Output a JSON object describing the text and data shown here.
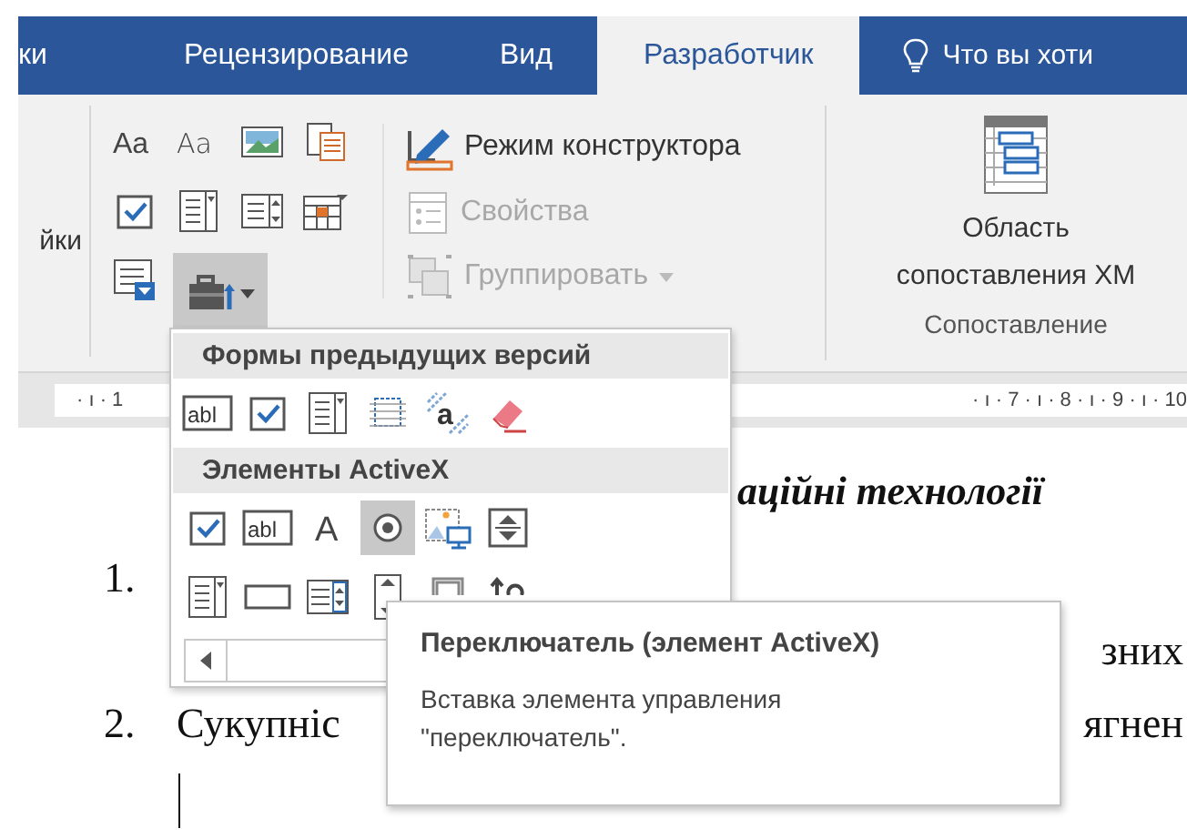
{
  "tabs": [
    {
      "label": "ки",
      "selected": false
    },
    {
      "label": "Рецензирование",
      "selected": false
    },
    {
      "label": "Вид",
      "selected": false
    },
    {
      "label": "Разработчик",
      "selected": true
    }
  ],
  "tell_me": {
    "text": "Что вы хоти"
  },
  "ribbon": {
    "left_fragment": "йки",
    "control_rows": [
      [
        {
          "kind": "aa",
          "glyph": "Aa"
        },
        {
          "kind": "aa-plain",
          "glyph": "Aa"
        },
        {
          "kind": "picture"
        },
        {
          "kind": "building-block"
        }
      ],
      [
        {
          "kind": "checkbox"
        },
        {
          "kind": "combo"
        },
        {
          "kind": "list"
        },
        {
          "kind": "date"
        }
      ],
      [
        {
          "kind": "repeat"
        },
        {
          "kind": "toolbox",
          "expanded": true
        }
      ]
    ],
    "commands": [
      {
        "kind": "design",
        "label": "Режим конструктора",
        "disabled": false
      },
      {
        "kind": "properties",
        "label": "Свойства",
        "disabled": true
      },
      {
        "kind": "group",
        "label": "Группировать",
        "disabled": true
      }
    ],
    "mapping": {
      "lines": [
        "Область",
        "сопоставления XM"
      ],
      "group_label": "Сопоставление"
    }
  },
  "ruler": {
    "left": "· ı · 1",
    "right": "· ı · 7 · ı · 8 · ı · 9 · ı · 10"
  },
  "document": {
    "heading": "аційні технології",
    "lines": [
      {
        "number": "1."
      },
      {
        "tail": "зних"
      },
      {
        "number": "2.",
        "text": "Сукупніс",
        "tail": "ягнен"
      }
    ]
  },
  "menu": {
    "sections": [
      {
        "title": "Формы предыдущих версий",
        "rows": [
          {
            "items": [
              {
                "kind": "textbox",
                "glyph": "abl",
                "selected": false
              },
              {
                "kind": "checkbox",
                "selected": false
              },
              {
                "kind": "combo",
                "selected": false
              },
              {
                "kind": "frame",
                "selected": false
              },
              {
                "kind": "shading",
                "glyph": "a",
                "selected": false
              },
              {
                "kind": "eraser",
                "selected": false
              }
            ]
          }
        ]
      },
      {
        "title": "Элементы ActiveX",
        "rows": [
          {
            "items": [
              {
                "kind": "checkbox",
                "selected": false
              },
              {
                "kind": "textbox",
                "glyph": "abl",
                "selected": false
              },
              {
                "kind": "label",
                "glyph": "A",
                "selected": false
              },
              {
                "kind": "radio",
                "selected": true
              },
              {
                "kind": "image",
                "selected": false
              },
              {
                "kind": "spin",
                "selected": false
              }
            ]
          },
          {
            "items": [
              {
                "kind": "combo",
                "selected": false
              },
              {
                "kind": "button",
                "selected": false
              },
              {
                "kind": "listbox",
                "selected": false
              },
              {
                "kind": "scroll",
                "selected": false
              },
              {
                "kind": "toggle",
                "selected": false
              },
              {
                "kind": "tools",
                "selected": false
              }
            ]
          }
        ]
      }
    ]
  },
  "tooltip": {
    "title": "Переключатель (элемент ActiveX)",
    "text": "Вставка элемента управления \"переключатель\"."
  }
}
